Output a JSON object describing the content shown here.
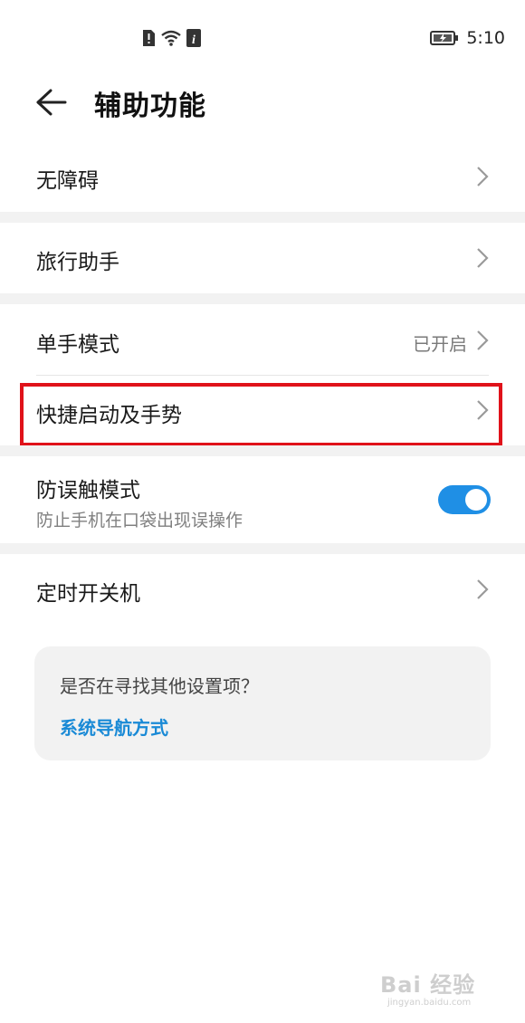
{
  "status_bar": {
    "time": "5:10",
    "icons": [
      "sim-alert-icon",
      "wifi-icon",
      "info-icon",
      "battery-charging-icon"
    ]
  },
  "header": {
    "title": "辅助功能",
    "back_icon": "back-arrow-icon"
  },
  "rows": {
    "accessibility": {
      "label": "无障碍"
    },
    "travel": {
      "label": "旅行助手"
    },
    "one_hand": {
      "label": "单手模式",
      "value": "已开启"
    },
    "shortcuts": {
      "label": "快捷启动及手势"
    },
    "pocket_mode": {
      "label": "防误触模式",
      "subtitle": "防止手机在口袋出现误操作",
      "toggle_on": true
    },
    "scheduled_power": {
      "label": "定时开关机"
    }
  },
  "tip_card": {
    "question": "是否在寻找其他设置项？",
    "link": "系统导航方式"
  },
  "colors": {
    "accent": "#1f8fe5",
    "link": "#1a8ad6",
    "highlight": "#e0121a",
    "section_gap": "#f2f2f2"
  },
  "watermark": {
    "big": "Bai 经验",
    "small": "jingyan.baidu.com"
  }
}
